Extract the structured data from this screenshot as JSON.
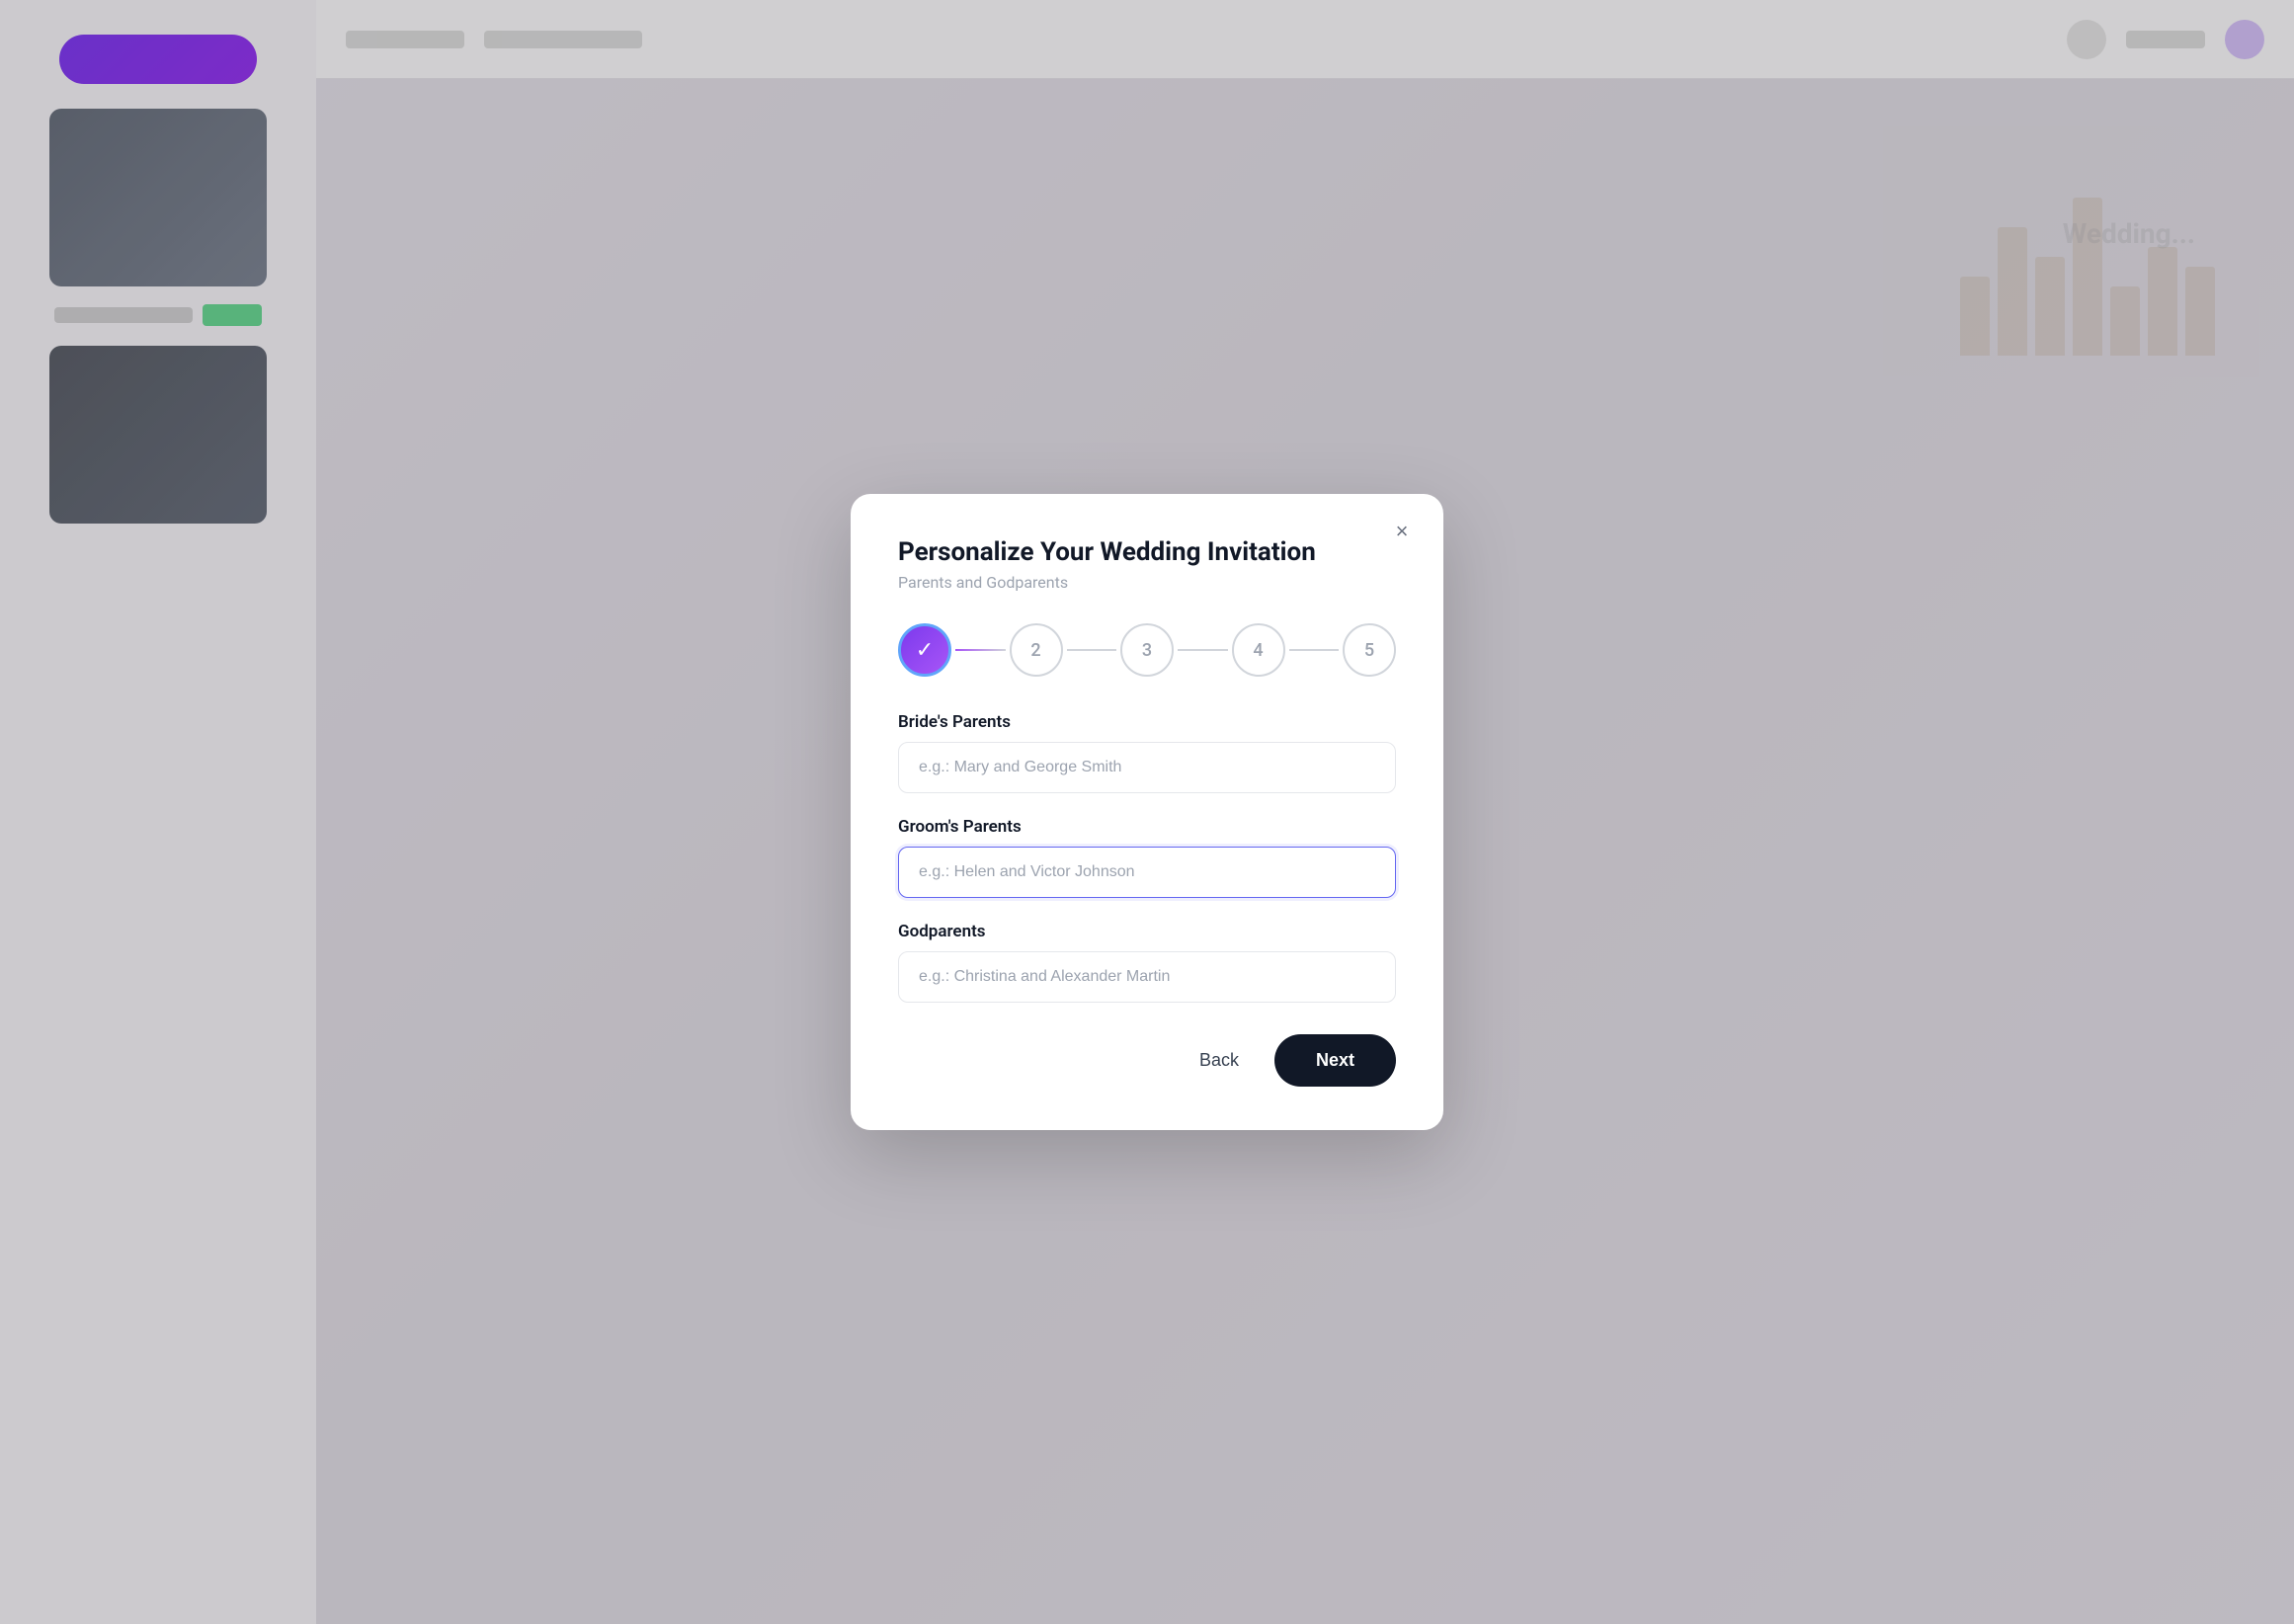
{
  "modal": {
    "title": "Personalize Your Wedding Invitation",
    "subtitle": "Parents and Godparents",
    "close_label": "×",
    "steps": [
      {
        "number": "✓",
        "state": "completed"
      },
      {
        "number": "2",
        "state": "inactive"
      },
      {
        "number": "3",
        "state": "inactive"
      },
      {
        "number": "4",
        "state": "inactive"
      },
      {
        "number": "5",
        "state": "inactive"
      }
    ],
    "fields": {
      "brides_parents": {
        "label": "Bride's Parents",
        "placeholder": "e.g.: Mary and George Smith",
        "value": ""
      },
      "grooms_parents": {
        "label": "Groom's Parents",
        "placeholder": "e.g.: Helen and Victor Johnson",
        "value": ""
      },
      "godparents": {
        "label": "Godparents",
        "placeholder": "e.g.: Christina and Alexander Martin",
        "value": ""
      }
    },
    "footer": {
      "back_label": "Back",
      "next_label": "Next"
    }
  }
}
